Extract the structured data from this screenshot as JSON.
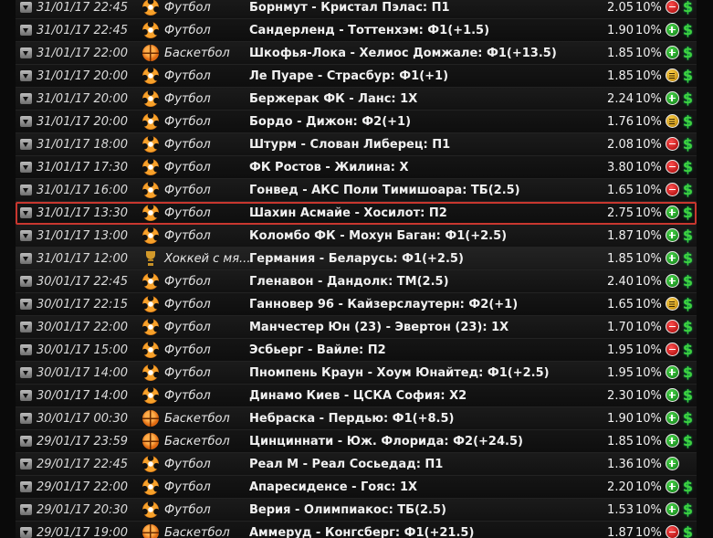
{
  "colors": {
    "win": "#2fbf3a",
    "loss": "#d01c1c",
    "return": "#e0a81c",
    "highlight": "#c8372f",
    "money": "#3fd23f"
  },
  "bets": [
    {
      "date": "31/01/17 22:45",
      "sport": "Футбол",
      "sport_icon": "football-icon",
      "event": "Борнмут - Кристал Пэлас: П1",
      "odds": "2.05",
      "stake": "10%",
      "result": "loss"
    },
    {
      "date": "31/01/17 22:45",
      "sport": "Футбол",
      "sport_icon": "football-icon",
      "event": "Сандерленд - Тоттенхэм: Ф1(+1.5)",
      "odds": "1.90",
      "stake": "10%",
      "result": "win"
    },
    {
      "date": "31/01/17 22:00",
      "sport": "Баскетбол",
      "sport_icon": "basketball-icon",
      "event": "Шкофья-Лока - Хелиос Домжале: Ф1(+13.5)",
      "odds": "1.85",
      "stake": "10%",
      "result": "win"
    },
    {
      "date": "31/01/17 20:00",
      "sport": "Футбол",
      "sport_icon": "football-icon",
      "event": "Ле Пуаре - Страсбур: Ф1(+1)",
      "odds": "1.85",
      "stake": "10%",
      "result": "return"
    },
    {
      "date": "31/01/17 20:00",
      "sport": "Футбол",
      "sport_icon": "football-icon",
      "event": "Бержерак ФК - Ланс: 1Х",
      "odds": "2.24",
      "stake": "10%",
      "result": "win"
    },
    {
      "date": "31/01/17 20:00",
      "sport": "Футбол",
      "sport_icon": "football-icon",
      "event": "Бордо - Дижон: Ф2(+1)",
      "odds": "1.76",
      "stake": "10%",
      "result": "return"
    },
    {
      "date": "31/01/17 18:00",
      "sport": "Футбол",
      "sport_icon": "football-icon",
      "event": "Штурм - Слован Либерец: П1",
      "odds": "2.08",
      "stake": "10%",
      "result": "loss"
    },
    {
      "date": "31/01/17 17:30",
      "sport": "Футбол",
      "sport_icon": "football-icon",
      "event": "ФК Ростов - Жилина: Х",
      "odds": "3.80",
      "stake": "10%",
      "result": "loss"
    },
    {
      "date": "31/01/17 16:00",
      "sport": "Футбол",
      "sport_icon": "football-icon",
      "event": "Гонвед - АКС Поли Тимишоара: ТБ(2.5)",
      "odds": "1.65",
      "stake": "10%",
      "result": "loss"
    },
    {
      "date": "31/01/17 13:30",
      "sport": "Футбол",
      "sport_icon": "football-icon",
      "event": "Шахин Асмайе - Хосилот: П2",
      "odds": "2.75",
      "stake": "10%",
      "result": "win",
      "highlight": true
    },
    {
      "date": "31/01/17 13:00",
      "sport": "Футбол",
      "sport_icon": "football-icon",
      "event": "Коломбо ФК - Мохун Баган: Ф1(+2.5)",
      "odds": "1.87",
      "stake": "10%",
      "result": "win"
    },
    {
      "date": "31/01/17 12:00",
      "sport": "Хоккей с мя...",
      "sport_icon": "trophy-icon",
      "event": "Германия - Беларусь: Ф1(+2.5)",
      "odds": "1.85",
      "stake": "10%",
      "result": "win",
      "live": true
    },
    {
      "date": "30/01/17 22:45",
      "sport": "Футбол",
      "sport_icon": "football-icon",
      "event": "Гленавон - Дандолк: ТМ(2.5)",
      "odds": "2.40",
      "stake": "10%",
      "result": "win"
    },
    {
      "date": "30/01/17 22:15",
      "sport": "Футбол",
      "sport_icon": "football-icon",
      "event": "Ганновер 96 - Кайзерслаутерн: Ф2(+1)",
      "odds": "1.65",
      "stake": "10%",
      "result": "return"
    },
    {
      "date": "30/01/17 22:00",
      "sport": "Футбол",
      "sport_icon": "football-icon",
      "event": "Манчестер Юн (23) - Эвертон (23): 1Х",
      "odds": "1.70",
      "stake": "10%",
      "result": "loss"
    },
    {
      "date": "30/01/17 15:00",
      "sport": "Футбол",
      "sport_icon": "football-icon",
      "event": "Эсбьерг - Вайле: П2",
      "odds": "1.95",
      "stake": "10%",
      "result": "loss"
    },
    {
      "date": "30/01/17 14:00",
      "sport": "Футбол",
      "sport_icon": "football-icon",
      "event": "Пномпень Краун - Хоум Юнайтед: Ф1(+2.5)",
      "odds": "1.95",
      "stake": "10%",
      "result": "win"
    },
    {
      "date": "30/01/17 14:00",
      "sport": "Футбол",
      "sport_icon": "football-icon",
      "event": "Динамо Киев - ЦСКА София: Х2",
      "odds": "2.30",
      "stake": "10%",
      "result": "win"
    },
    {
      "date": "30/01/17 00:30",
      "sport": "Баскетбол",
      "sport_icon": "basketball-icon",
      "event": "Небраска - Пердью: Ф1(+8.5)",
      "odds": "1.90",
      "stake": "10%",
      "result": "win"
    },
    {
      "date": "29/01/17 23:59",
      "sport": "Баскетбол",
      "sport_icon": "basketball-icon",
      "event": "Цинциннати - Юж. Флорида: Ф2(+24.5)",
      "odds": "1.85",
      "stake": "10%",
      "result": "win"
    },
    {
      "date": "29/01/17 22:45",
      "sport": "Футбол",
      "sport_icon": "football-icon",
      "event": "Реал М - Реал Сосьедад: П1",
      "odds": "1.36",
      "stake": "10%",
      "result": "win",
      "no_money": true
    },
    {
      "date": "29/01/17 22:00",
      "sport": "Футбол",
      "sport_icon": "football-icon",
      "event": "Апаресиденсе - Гояс: 1Х",
      "odds": "2.20",
      "stake": "10%",
      "result": "win"
    },
    {
      "date": "29/01/17 20:30",
      "sport": "Футбол",
      "sport_icon": "football-icon",
      "event": "Верия - Олимпиакос: ТБ(2.5)",
      "odds": "1.53",
      "stake": "10%",
      "result": "win"
    },
    {
      "date": "29/01/17 19:00",
      "sport": "Баскетбол",
      "sport_icon": "basketball-icon",
      "event": "Аммеруд - Конгсберг: Ф1(+21.5)",
      "odds": "1.87",
      "stake": "10%",
      "result": "loss"
    }
  ],
  "money_symbol": "$"
}
